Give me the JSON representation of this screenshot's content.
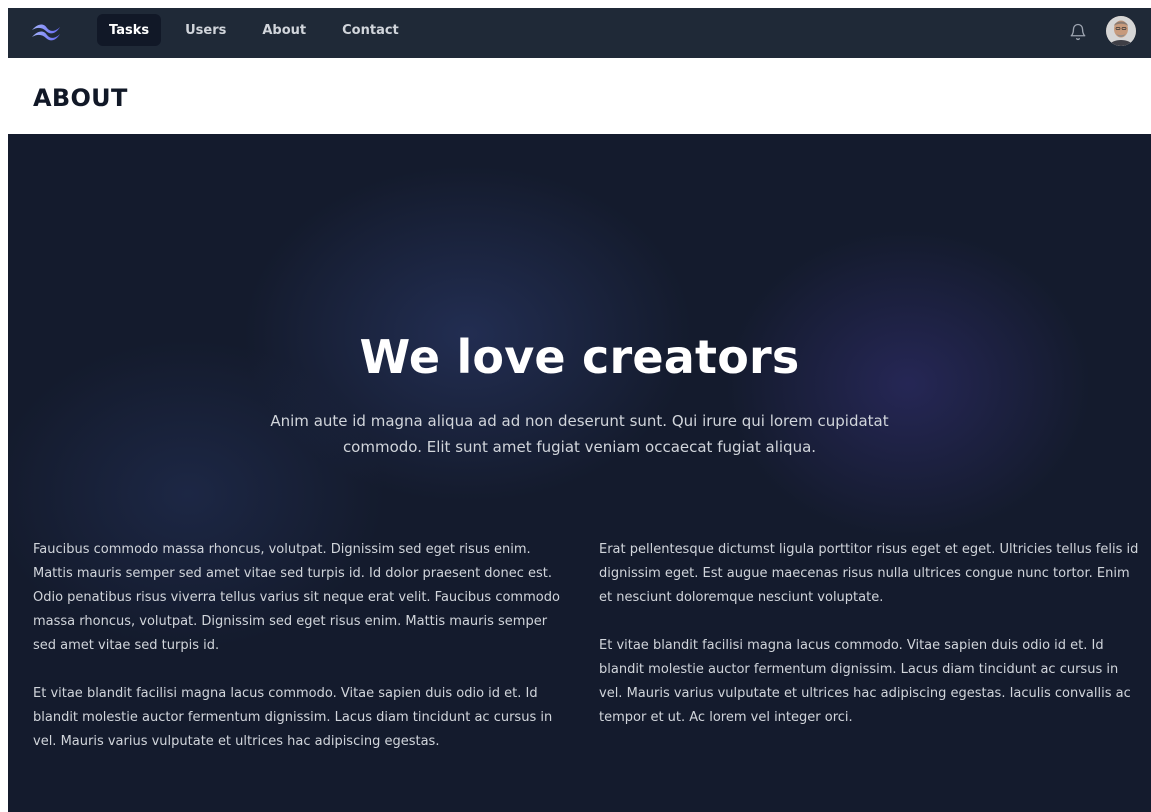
{
  "nav": {
    "links": [
      {
        "label": "Tasks",
        "active": true
      },
      {
        "label": "Users",
        "active": false
      },
      {
        "label": "About",
        "active": false
      },
      {
        "label": "Contact",
        "active": false
      }
    ],
    "logo_icon": "waves-logo-icon",
    "notification_icon": "bell-icon",
    "avatar_icon": "user-avatar"
  },
  "header": {
    "title": "ABOUT"
  },
  "hero": {
    "title": "We love creators",
    "subtitle": "Anim aute id magna aliqua ad ad non deserunt sunt. Qui irure qui lorem cupidatat commodo. Elit sunt amet fugiat veniam occaecat fugiat aliqua."
  },
  "columns": {
    "left": [
      "Faucibus commodo massa rhoncus, volutpat. Dignissim sed eget risus enim. Mattis mauris semper sed amet vitae sed turpis id. Id dolor praesent donec est. Odio penatibus risus viverra tellus varius sit neque erat velit. Faucibus commodo massa rhoncus, volutpat. Dignissim sed eget risus enim. Mattis mauris semper sed amet vitae sed turpis id.",
      "Et vitae blandit facilisi magna lacus commodo. Vitae sapien duis odio id et. Id blandit molestie auctor fermentum dignissim. Lacus diam tincidunt ac cursus in vel. Mauris varius vulputate et ultrices hac adipiscing egestas."
    ],
    "right": [
      "Erat pellentesque dictumst ligula porttitor risus eget et eget. Ultricies tellus felis id dignissim eget. Est augue maecenas risus nulla ultrices congue nunc tortor. Enim et nesciunt doloremque nesciunt voluptate.",
      "Et vitae blandit facilisi magna lacus commodo. Vitae sapien duis odio id et. Id blandit molestie auctor fermentum dignissim. Lacus diam tincidunt ac cursus in vel. Mauris varius vulputate et ultrices hac adipiscing egestas. Iaculis convallis ac tempor et ut. Ac lorem vel integer orci."
    ]
  },
  "colors": {
    "nav_bg": "#1f2937",
    "active_tab_bg": "#111827",
    "hero_bg": "#141b2d",
    "logo_accent": "#818cf8"
  }
}
